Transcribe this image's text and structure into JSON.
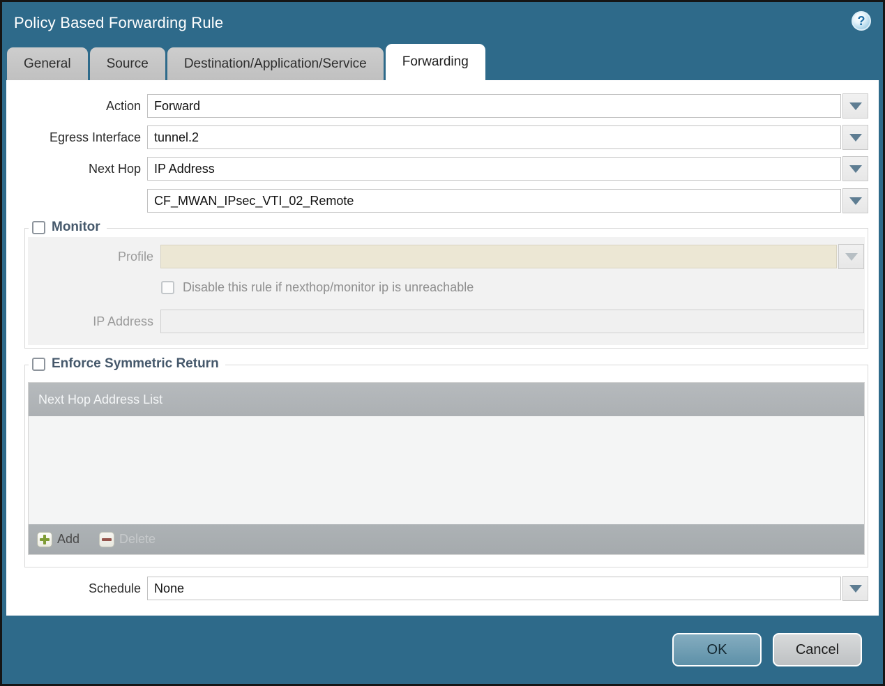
{
  "window": {
    "title": "Policy Based Forwarding Rule",
    "help_glyph": "?"
  },
  "tabs": [
    {
      "label": "General",
      "active": false
    },
    {
      "label": "Source",
      "active": false
    },
    {
      "label": "Destination/Application/Service",
      "active": false
    },
    {
      "label": "Forwarding",
      "active": true
    }
  ],
  "form": {
    "action": {
      "label": "Action",
      "value": "Forward"
    },
    "egress_interface": {
      "label": "Egress Interface",
      "value": "tunnel.2"
    },
    "next_hop": {
      "label": "Next Hop",
      "value": "IP Address"
    },
    "next_hop_address": {
      "value": "CF_MWAN_IPsec_VTI_02_Remote"
    },
    "schedule": {
      "label": "Schedule",
      "value": "None"
    }
  },
  "monitor": {
    "legend": "Monitor",
    "checked": false,
    "profile": {
      "label": "Profile",
      "value": ""
    },
    "disable_rule": {
      "label": "Disable this rule if nexthop/monitor ip is unreachable",
      "checked": false
    },
    "ip_address": {
      "label": "IP Address",
      "value": ""
    }
  },
  "symmetric_return": {
    "legend": "Enforce Symmetric Return",
    "checked": false,
    "table": {
      "header": "Next Hop Address List",
      "rows": []
    },
    "add_label": "Add",
    "delete_label": "Delete"
  },
  "footer": {
    "ok_label": "OK",
    "cancel_label": "Cancel"
  },
  "colors": {
    "titlebar": "#2e6a8a",
    "active_tab": "#ffffff",
    "inactive_tab": "#c6c6c6",
    "legend_text": "#45586b",
    "table_header": "#b0b4b7",
    "ok_button": "#6fa0b6",
    "cancel_button": "#c9cccd",
    "profile_disabled_bg": "#ece7d4",
    "add_icon_green": "#7f9c35",
    "delete_icon_red": "#95544c"
  }
}
